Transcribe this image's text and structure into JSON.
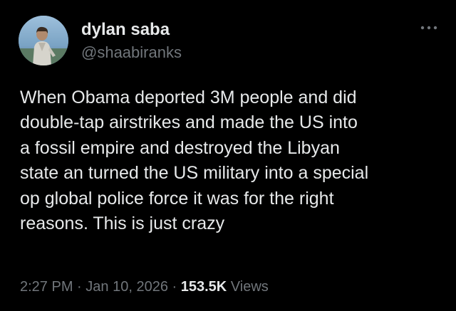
{
  "author": {
    "display_name": "dylan saba",
    "handle": "@shaabiranks",
    "avatar_icon": "profile-photo-icon"
  },
  "menu_icon": "more-options-icon",
  "tweet": {
    "lines": [
      "When Obama deported 3M people and did",
      "double-tap airstrikes and made the US into",
      "a fossil empire and destroyed the Libyan",
      "state an turned the US military into a special",
      "op global police force it was for the right",
      "reasons. This is just crazy"
    ]
  },
  "meta": {
    "time": "2:27 PM",
    "separator": "·",
    "date": "Jan 10, 2026",
    "views_count": "153.5K",
    "views_label": "Views"
  },
  "colors": {
    "background": "#000000",
    "primary_text": "#e7e9ea",
    "secondary_text": "#71767b"
  }
}
